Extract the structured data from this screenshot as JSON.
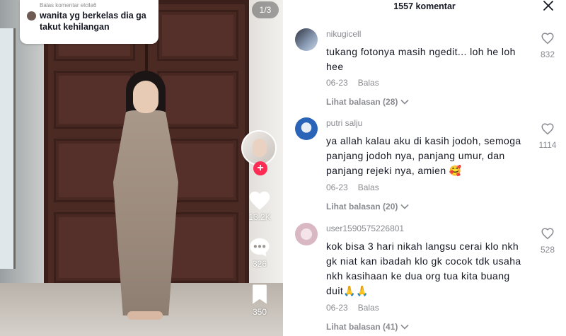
{
  "video": {
    "reply_bubble": {
      "header": "Balas komentar elcila6",
      "text": "wanita yg berkelas dia ga takut kehilangan"
    },
    "page_indicator": "1/3",
    "actions": {
      "likes": "13.2K",
      "comments": "326",
      "saves": "350"
    },
    "icons": {
      "follow": "+",
      "like": "heart-icon",
      "comment": "comment-icon",
      "save": "bookmark-icon"
    }
  },
  "comments_panel": {
    "count_label": "1557 komentar",
    "reply_label": "Balas",
    "items": [
      {
        "username": "nikugicell",
        "text": "tukang fotonya masih ngedit... loh he loh hee",
        "date": "06-23",
        "replies": "Lihat balasan (28)",
        "likes": "832"
      },
      {
        "username": "putri salju",
        "text": "ya allah kalau aku di kasih jodoh, semoga panjang jodoh nya, panjang umur, dan panjang rejeki nya, amien 🥰",
        "date": "06-23",
        "replies": "Lihat balasan (20)",
        "likes": "1114"
      },
      {
        "username": "user1590575226801",
        "text": "kok bisa 3 hari nikah langsu cerai klo nkh gk niat kan ibadah klo gk cocok tdk usaha nkh kasihaan ke dua org tua kita buang duit🙏🙏",
        "date": "06-23",
        "replies": "Lihat balasan (41)",
        "likes": "528"
      }
    ]
  }
}
